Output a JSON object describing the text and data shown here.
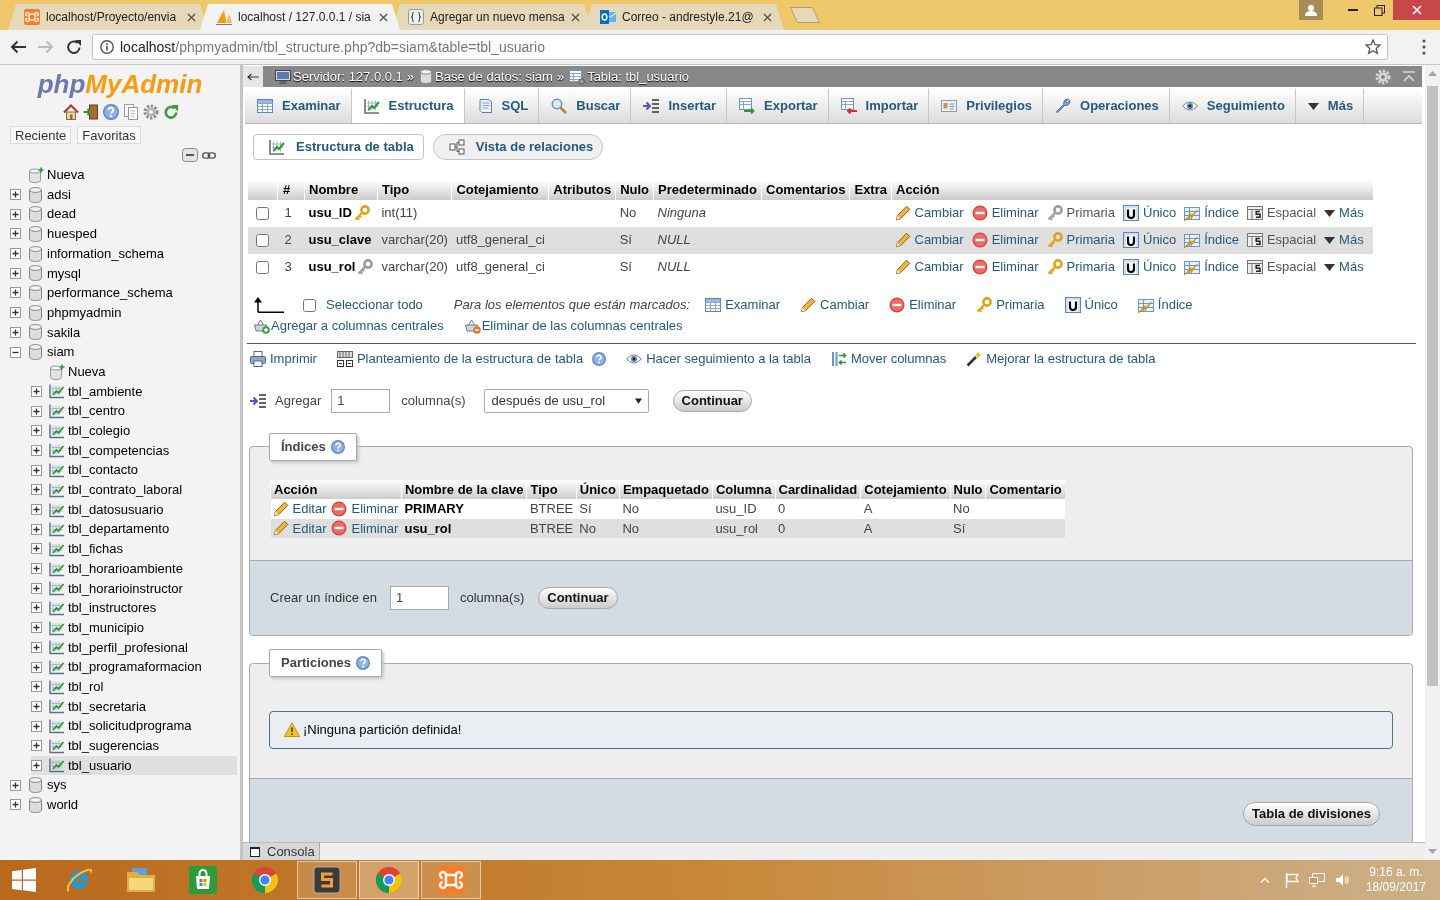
{
  "browser": {
    "tabs": [
      {
        "title": "localhost/Proyecto/envia",
        "selected": false
      },
      {
        "title": "localhost / 127.0.0.1 / sia",
        "selected": true
      },
      {
        "title": "Agregar un nuevo mensa",
        "selected": false
      },
      {
        "title": "Correo - andrestyle.21@",
        "selected": false
      }
    ],
    "address": {
      "host": "localhost",
      "path": "/phpmyadmin/tbl_structure.php?db=siam&table=tbl_usuario"
    }
  },
  "sidebar": {
    "logo": {
      "prefix": "php",
      "name": "MyAdmin"
    },
    "buttons": [
      "Reciente",
      "Favoritas"
    ],
    "tree": [
      {
        "kind": "new",
        "label": "Nueva",
        "selected": false
      },
      {
        "kind": "database",
        "label": "adsi",
        "expanded": false,
        "selected": false
      },
      {
        "kind": "database",
        "label": "dead",
        "expanded": false,
        "selected": false
      },
      {
        "kind": "database",
        "label": "huesped",
        "expanded": false,
        "selected": false
      },
      {
        "kind": "database",
        "label": "information_schema",
        "expanded": false,
        "selected": false
      },
      {
        "kind": "database",
        "label": "mysql",
        "expanded": false,
        "selected": false
      },
      {
        "kind": "database",
        "label": "performance_schema",
        "expanded": false,
        "selected": false
      },
      {
        "kind": "database",
        "label": "phpmyadmin",
        "expanded": false,
        "selected": false
      },
      {
        "kind": "database",
        "label": "sakila",
        "expanded": false,
        "selected": false
      },
      {
        "kind": "database",
        "label": "siam",
        "expanded": true,
        "selected": false,
        "children": [
          {
            "kind": "new",
            "label": "Nueva",
            "selected": false
          },
          {
            "kind": "table",
            "label": "tbl_ambiente",
            "expanded": false,
            "selected": false
          },
          {
            "kind": "table",
            "label": "tbl_centro",
            "expanded": false,
            "selected": false
          },
          {
            "kind": "table",
            "label": "tbl_colegio",
            "expanded": false,
            "selected": false
          },
          {
            "kind": "table",
            "label": "tbl_competencias",
            "expanded": false,
            "selected": false
          },
          {
            "kind": "table",
            "label": "tbl_contacto",
            "expanded": false,
            "selected": false
          },
          {
            "kind": "table",
            "label": "tbl_contrato_laboral",
            "expanded": false,
            "selected": false
          },
          {
            "kind": "table",
            "label": "tbl_datosusuario",
            "expanded": false,
            "selected": false
          },
          {
            "kind": "table",
            "label": "tbl_departamento",
            "expanded": false,
            "selected": false
          },
          {
            "kind": "table",
            "label": "tbl_fichas",
            "expanded": false,
            "selected": false
          },
          {
            "kind": "table",
            "label": "tbl_horarioambiente",
            "expanded": false,
            "selected": false
          },
          {
            "kind": "table",
            "label": "tbl_horarioinstructor",
            "expanded": false,
            "selected": false
          },
          {
            "kind": "table",
            "label": "tbl_instructores",
            "expanded": false,
            "selected": false
          },
          {
            "kind": "table",
            "label": "tbl_municipio",
            "expanded": false,
            "selected": false
          },
          {
            "kind": "table",
            "label": "tbl_perfil_profesional",
            "expanded": false,
            "selected": false
          },
          {
            "kind": "table",
            "label": "tbl_programaformacion",
            "expanded": false,
            "selected": false
          },
          {
            "kind": "table",
            "label": "tbl_rol",
            "expanded": false,
            "selected": false
          },
          {
            "kind": "table",
            "label": "tbl_secretaria",
            "expanded": false,
            "selected": false
          },
          {
            "kind": "table",
            "label": "tbl_solicitudprograma",
            "expanded": false,
            "selected": false
          },
          {
            "kind": "table",
            "label": "tbl_sugerencias",
            "expanded": false,
            "selected": false
          },
          {
            "kind": "table",
            "label": "tbl_usuario",
            "expanded": false,
            "selected": true
          }
        ]
      },
      {
        "kind": "database",
        "label": "sys",
        "expanded": false,
        "selected": false
      },
      {
        "kind": "database",
        "label": "world",
        "expanded": false,
        "selected": false
      }
    ]
  },
  "breadcrumb": [
    {
      "label": "Servidor: 127.0.0.1",
      "separator": "»"
    },
    {
      "label": "Base de datos: siam",
      "separator": "»"
    },
    {
      "label": "Tabla: tbl_usuario"
    }
  ],
  "menu_tabs": [
    {
      "label": "Examinar",
      "selected": false
    },
    {
      "label": "Estructura",
      "selected": true
    },
    {
      "label": "SQL",
      "selected": false
    },
    {
      "label": "Buscar",
      "selected": false
    },
    {
      "label": "Insertar",
      "selected": false
    },
    {
      "label": "Exportar",
      "selected": false
    },
    {
      "label": "Importar",
      "selected": false
    },
    {
      "label": "Privilegios",
      "selected": false
    },
    {
      "label": "Operaciones",
      "selected": false
    },
    {
      "label": "Seguimiento",
      "selected": false
    },
    {
      "label": "Más",
      "selected": false
    }
  ],
  "sub_tabs": [
    {
      "label": "Estructura de tabla",
      "selected": true
    },
    {
      "label": "Vista de relaciones",
      "selected": false
    }
  ],
  "structure": {
    "columns": [
      "#",
      "Nombre",
      "Tipo",
      "Cotejamiento",
      "Atributos",
      "Nulo",
      "Predeterminado",
      "Comentarios",
      "Extra",
      "Acción"
    ],
    "rows": [
      {
        "checked": false,
        "number": "1",
        "name": "usu_ID",
        "indexed": true,
        "primary_key": true,
        "type": "int(11)",
        "null": "No",
        "default": "Ninguna",
        "actions": [
          {
            "label": "Cambiar",
            "disabled": false
          },
          {
            "label": "Eliminar",
            "disabled": false
          },
          {
            "label": "Primaria",
            "disabled": true
          },
          {
            "label": "Único",
            "disabled": false
          },
          {
            "label": "Índice",
            "disabled": false
          },
          {
            "label": "Espacial",
            "disabled": true
          },
          {
            "label": "Más",
            "disabled": false
          }
        ]
      },
      {
        "checked": false,
        "number": "2",
        "name": "usu_clave",
        "indexed": false,
        "type": "varchar(20)",
        "collation": "utf8_general_ci",
        "null": "Sí",
        "default": "NULL",
        "actions": [
          {
            "label": "Cambiar",
            "disabled": false
          },
          {
            "label": "Eliminar",
            "disabled": false
          },
          {
            "label": "Primaria",
            "disabled": false
          },
          {
            "label": "Único",
            "disabled": false
          },
          {
            "label": "Índice",
            "disabled": false
          },
          {
            "label": "Espacial",
            "disabled": true
          },
          {
            "label": "Más",
            "disabled": false
          }
        ]
      },
      {
        "checked": false,
        "number": "3",
        "name": "usu_rol",
        "indexed": true,
        "primary_key": false,
        "type": "varchar(20)",
        "collation": "utf8_general_ci",
        "null": "Sí",
        "default": "NULL",
        "actions": [
          {
            "label": "Cambiar",
            "disabled": false
          },
          {
            "label": "Eliminar",
            "disabled": false
          },
          {
            "label": "Primaria",
            "disabled": false
          },
          {
            "label": "Único",
            "disabled": false
          },
          {
            "label": "Índice",
            "disabled": false
          },
          {
            "label": "Espacial",
            "disabled": true
          },
          {
            "label": "Más",
            "disabled": false
          }
        ]
      }
    ]
  },
  "bulk": {
    "select_all": {
      "label": "Seleccionar todo",
      "checked": false
    },
    "prompt": "Para los elementos que están marcados:",
    "actions": [
      "Examinar",
      "Cambiar",
      "Eliminar",
      "Primaria",
      "Único",
      "Índice"
    ],
    "central_actions": [
      "Agregar a columnas centrales",
      "Eliminar de las columnas centrales"
    ]
  },
  "table_links": [
    {
      "label": "Imprimir"
    },
    {
      "label": "Planteamiento de la estructura de tabla",
      "help": true
    },
    {
      "label": "Hacer seguimiento a la tabla"
    },
    {
      "label": "Mover columnas"
    },
    {
      "label": "Mejorar la estructura de tabla"
    }
  ],
  "add_columns": {
    "label": "Agregar",
    "count": "1",
    "unit": "columna(s)",
    "position": "después de usu_rol",
    "button": "Continuar"
  },
  "indexes": {
    "legend": "Índices",
    "columns": [
      "Acción",
      "Nombre de la clave",
      "Tipo",
      "Único",
      "Empaquetado",
      "Columna",
      "Cardinalidad",
      "Cotejamiento",
      "Nulo",
      "Comentario"
    ],
    "rows": [
      {
        "actions": [
          "Editar",
          "Eliminar"
        ],
        "key_name": "PRIMARY",
        "type": "BTREE",
        "unique": "Sí",
        "packed": "No",
        "column": "usu_ID",
        "cardinality": "0",
        "collation": "A",
        "null": "No"
      },
      {
        "actions": [
          "Editar",
          "Eliminar"
        ],
        "key_name": "usu_rol",
        "type": "BTREE",
        "unique": "No",
        "packed": "No",
        "column": "usu_rol",
        "cardinality": "0",
        "collation": "A",
        "null": "Sí"
      }
    ],
    "create": {
      "label": "Crear un índice en",
      "count": "1",
      "unit": "columna(s)",
      "button": "Continuar"
    }
  },
  "partitions": {
    "legend": "Particiones",
    "notice": "¡Ninguna partición definida!",
    "button": "Tabla de divisiones"
  },
  "console": {
    "label": "Consola"
  },
  "taskbar": {
    "apps": [
      {
        "running": false,
        "selected": false
      },
      {
        "running": false,
        "selected": false
      },
      {
        "running": false,
        "selected": false
      },
      {
        "running": false,
        "selected": false
      },
      {
        "running": true,
        "selected": false
      },
      {
        "running": true,
        "selected": true
      },
      {
        "running": true,
        "selected": false
      }
    ],
    "time": "9:16 a. m.",
    "date": "18/09/2017"
  }
}
